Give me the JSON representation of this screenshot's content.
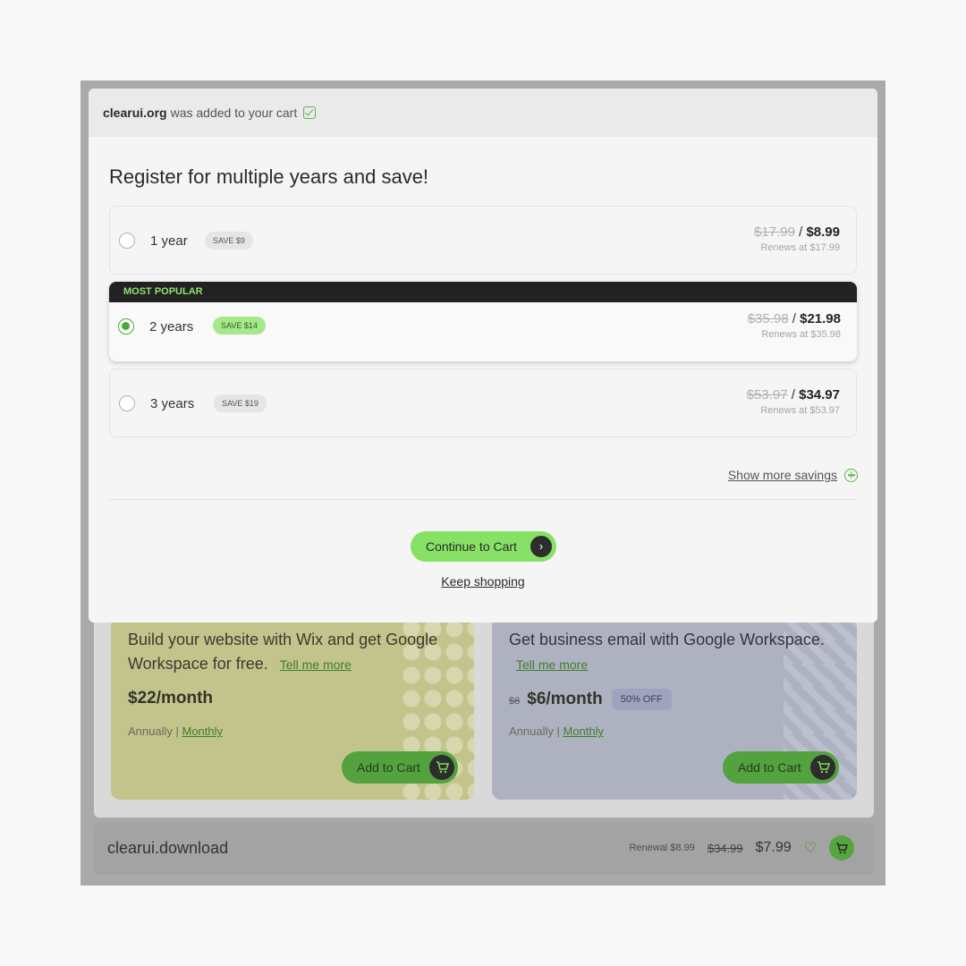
{
  "modal": {
    "domain": "clearui.org",
    "added_text": "was added to your cart",
    "title": "Register for multiple years and save!",
    "options": [
      {
        "label": "1 year",
        "save": "SAVE $9",
        "old_price": "$17.99",
        "price": "$8.99",
        "renew": "Renews at $17.99",
        "selected": false
      },
      {
        "label": "2 years",
        "save": "SAVE $14",
        "old_price": "$35.98",
        "price": "$21.98",
        "renew": "Renews at $35.98",
        "selected": true,
        "badge": "MOST POPULAR"
      },
      {
        "label": "3 years",
        "save": "SAVE $19",
        "old_price": "$53.97",
        "price": "$34.97",
        "renew": "Renews at $53.97",
        "selected": false
      }
    ],
    "price_separator": "/",
    "show_more": "Show more savings",
    "continue_label": "Continue to Cart",
    "keep_shopping": "Keep shopping"
  },
  "promos": {
    "wix": {
      "headline": "Build your website with Wix and get Google Workspace for free.",
      "link": "Tell me more",
      "price": "$22/month",
      "billing_prefix": "Annually |",
      "billing_link": "Monthly",
      "button": "Add to Cart",
      "color": "#c3c48c"
    },
    "gws": {
      "headline": "Get business email with Google Workspace.",
      "link": "Tell me more",
      "old_price": "$8",
      "price": "$6/month",
      "discount": "50% OFF",
      "billing_prefix": "Annually |",
      "billing_link": "Monthly",
      "button": "Add to Cart",
      "color": "#aeb2c0"
    }
  },
  "domain_row": {
    "name": "clearui.download",
    "renewal": "Renewal $8.99",
    "old_price": "$34.99",
    "price": "$7.99"
  },
  "icons": [
    "check-icon",
    "chevron-right-icon",
    "plus-circle-icon",
    "cart-icon",
    "heart-icon"
  ],
  "colors": {
    "accent": "#87e164",
    "selected": "#4ba93a",
    "banner": "#222222"
  }
}
